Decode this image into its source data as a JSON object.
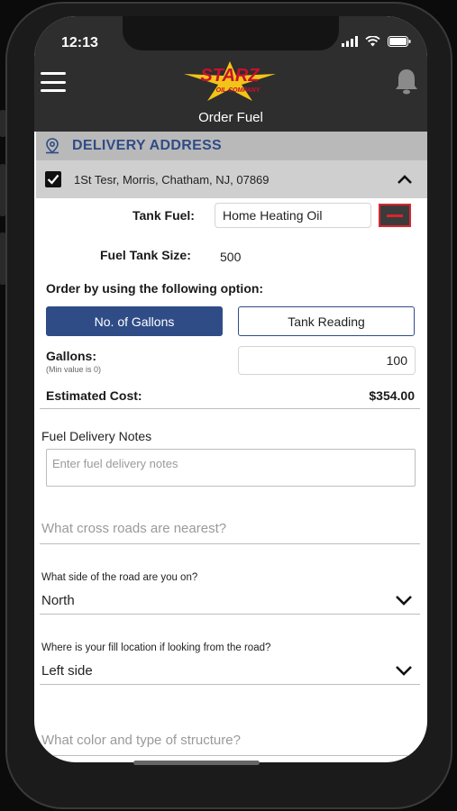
{
  "status": {
    "time": "12:13"
  },
  "header": {
    "title": "Order Fuel",
    "logo_text": "STARZ",
    "logo_sub": "OIL COMPANY"
  },
  "delivery": {
    "section_label": "DELIVERY ADDRESS",
    "address": "1St Tesr, Morris, Chatham, NJ, 07869"
  },
  "form": {
    "tank_fuel_label": "Tank Fuel:",
    "tank_fuel_value": "Home Heating Oil",
    "tank_size_label": "Fuel Tank Size:",
    "tank_size_value": "500",
    "order_option_label": "Order by using the following option:",
    "option_gallons": "No. of Gallons",
    "option_tank_reading": "Tank Reading",
    "gallons_label": "Gallons:",
    "gallons_hint": "(Min value is 0)",
    "gallons_value": "100",
    "estimated_cost_label": "Estimated Cost:",
    "estimated_cost_value": "$354.00",
    "notes_label": "Fuel Delivery Notes",
    "notes_placeholder": "Enter fuel delivery notes",
    "cross_roads_placeholder": "What cross roads are nearest?",
    "road_side_label": "What side of the road are you on?",
    "road_side_value": "North",
    "fill_location_label": "Where is your fill location if looking from the road?",
    "fill_location_value": "Left side",
    "structure_placeholder": "What color and type of structure?"
  },
  "colors": {
    "accent": "#2f4c87",
    "danger": "#d9262e",
    "header_bg": "#2e2e2e"
  }
}
